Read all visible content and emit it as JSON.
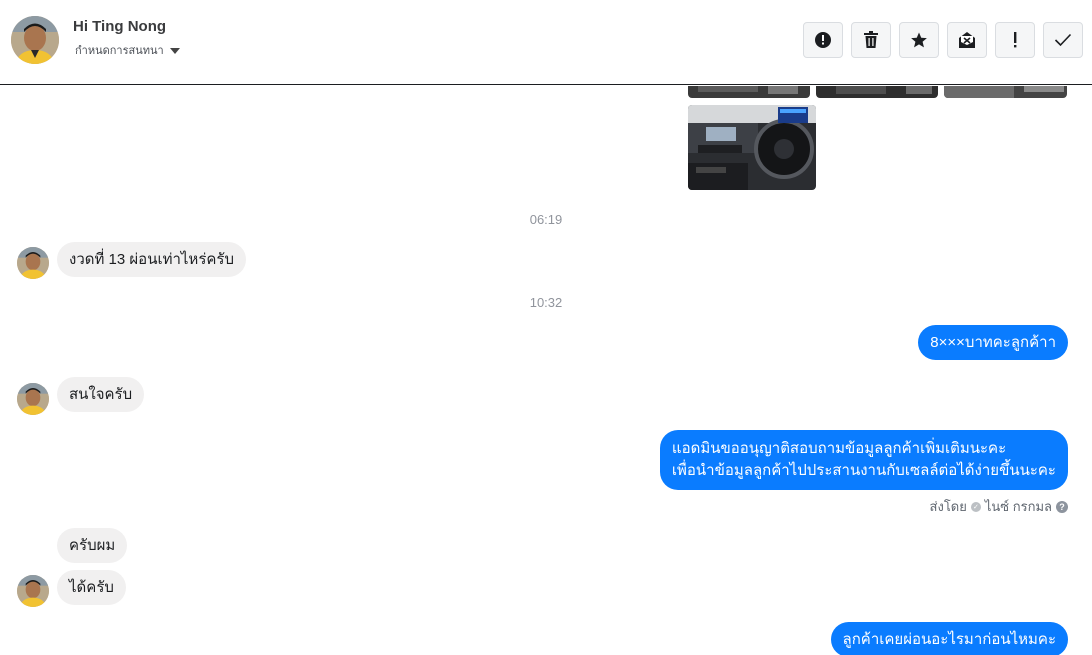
{
  "header": {
    "name": "Hi Ting Nong",
    "subtitle": "กำหนดการสนทนา",
    "toolbar": [
      {
        "name": "report-button",
        "icon": "alert-circle-icon"
      },
      {
        "name": "delete-button",
        "icon": "trash-icon"
      },
      {
        "name": "star-button",
        "icon": "star-icon"
      },
      {
        "name": "mark-unread-button",
        "icon": "envelope-x-icon"
      },
      {
        "name": "spam-button",
        "icon": "exclamation-icon"
      },
      {
        "name": "done-button",
        "icon": "check-icon"
      }
    ]
  },
  "messages": {
    "time1": "06:19",
    "m1": "งวดที่ 13 ผ่อนเท่าไหร่ครับ",
    "time2": "10:32",
    "m2": "8×××บาทคะลูกค้าา",
    "m3": "สนใจครับ",
    "m4_line1": "แอดมินขออนุญาติสอบถามข้อมูลลูกค้าเพิ่มเติมนะคะ",
    "m4_line2": "เพื่อนำข้อมูลลูกค้าไปประสานงานกับเซลล์ต่อได้ง่ายขึ้นนะคะ",
    "sent_by_prefix": "ส่งโดย",
    "sent_by_name": "ไนซ์ กรกมล",
    "m5": "ครับผม",
    "m6": "ได้ครับ",
    "m7": "ลูกค้าเคยผ่อนอะไรมาก่อนไหมคะ"
  },
  "colors": {
    "outgoing_bubble": "#0a7cff",
    "incoming_bubble": "#f1f0f0"
  }
}
